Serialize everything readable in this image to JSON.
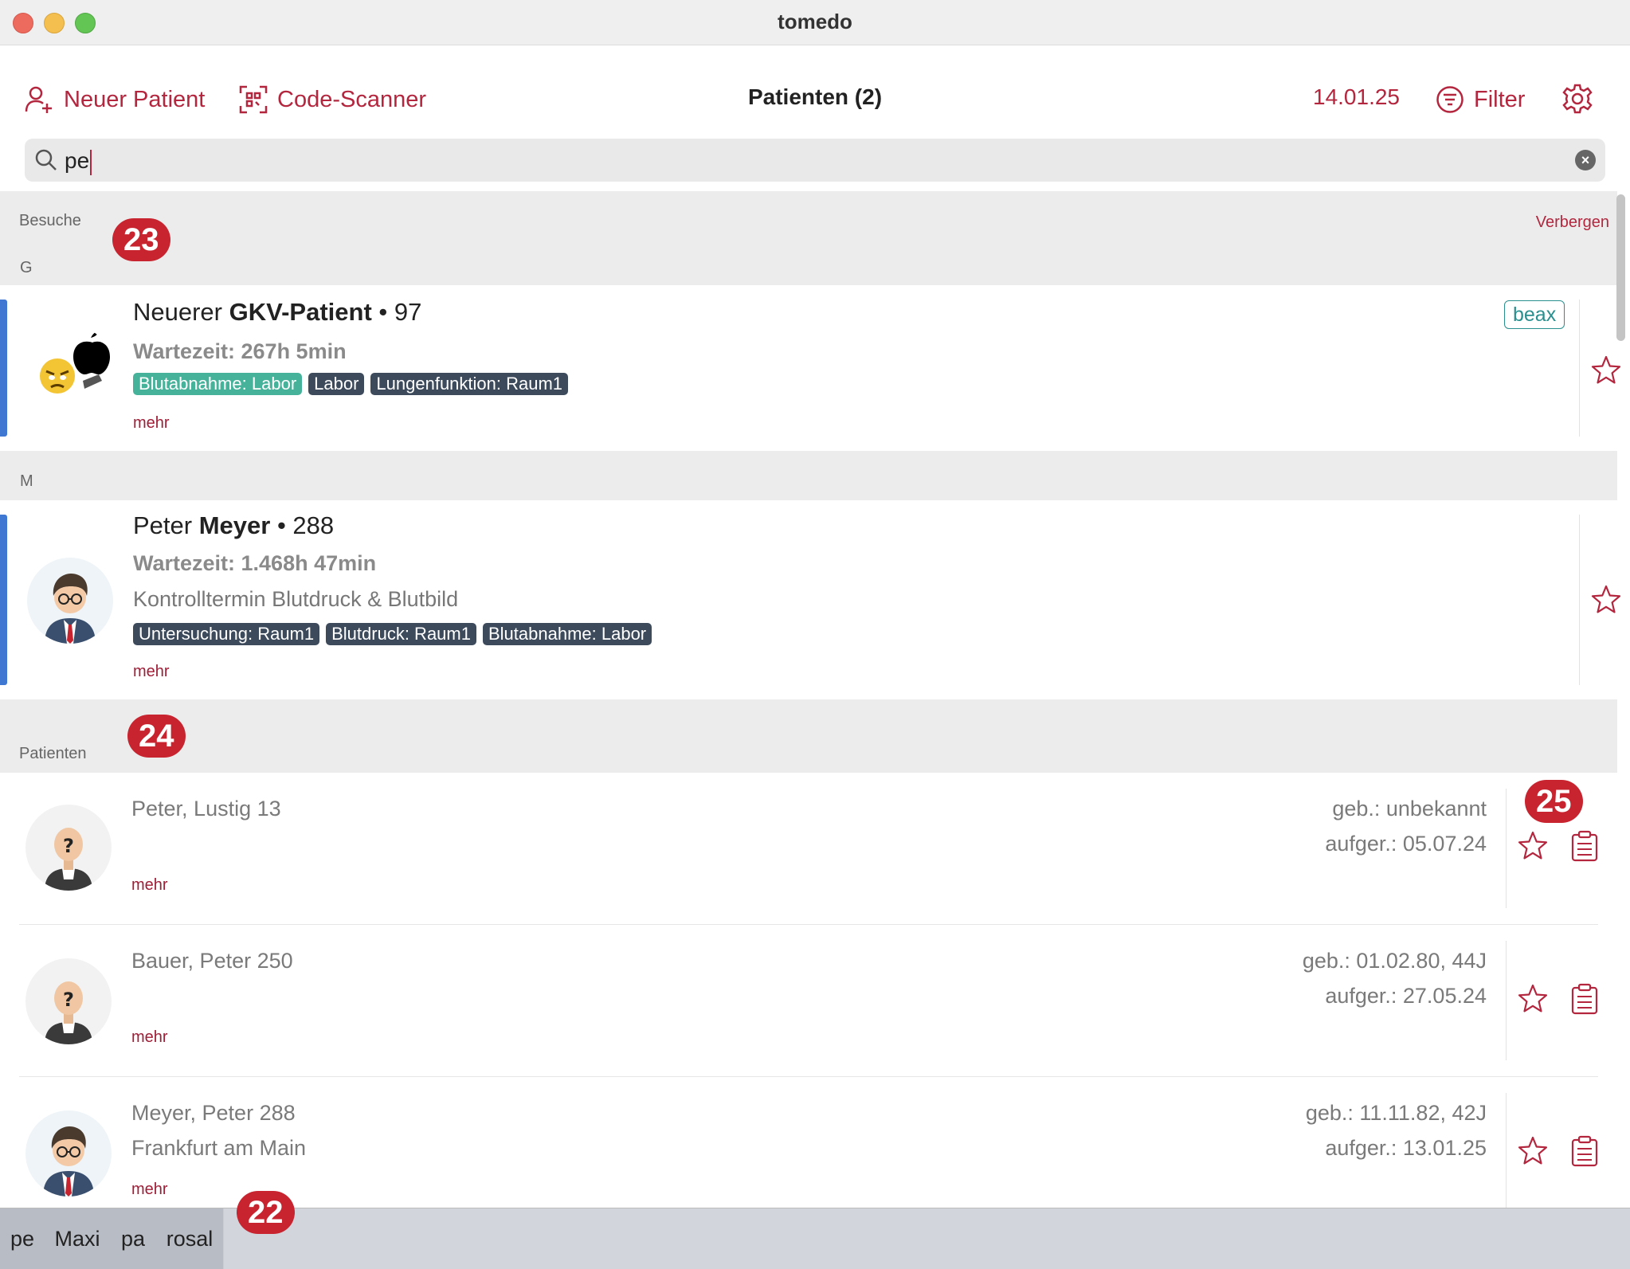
{
  "window": {
    "title": "tomedo"
  },
  "toolbar": {
    "new_patient": "Neuer Patient",
    "code_scanner": "Code-Scanner",
    "title": "Patienten (2)",
    "date": "14.01.25",
    "filter": "Filter"
  },
  "search": {
    "value": "pe"
  },
  "visits": {
    "section_label": "Besuche",
    "hide_label": "Verbergen",
    "groups": [
      {
        "letter": "G"
      },
      {
        "letter": "M"
      }
    ],
    "items": [
      {
        "first_name": "Neuerer",
        "last_name": "GKV-Patient",
        "number": "• 97",
        "wait": "Wartezeit: 267h 5min",
        "note": "",
        "tags": [
          "Blutabnahme: Labor",
          "Labor",
          "Lungenfunktion: Raum1"
        ],
        "more": "mehr",
        "badge": "beax"
      },
      {
        "first_name": "Peter",
        "last_name": "Meyer",
        "number": "• 288",
        "wait": "Wartezeit: 1.468h 47min",
        "note": "Kontrolltermin Blutdruck & Blutbild",
        "tags": [
          "Untersuchung: Raum1",
          "Blutdruck: Raum1",
          "Blutabnahme: Labor"
        ],
        "more": "mehr"
      }
    ]
  },
  "patients": {
    "section_label": "Patienten",
    "items": [
      {
        "name": "Peter, Lustig  13",
        "sub": "",
        "birth": "geb.: unbekannt",
        "called": "aufger.: 05.07.24",
        "more": "mehr"
      },
      {
        "name": "Bauer, Peter  250",
        "sub": "",
        "birth": "geb.: 01.02.80, 44J",
        "called": "aufger.: 27.05.24",
        "more": "mehr"
      },
      {
        "name": "Meyer, Peter  288",
        "sub": "Frankfurt am Main",
        "birth": "geb.: 11.11.82, 42J",
        "called": "aufger.: 13.01.25",
        "more": "mehr"
      }
    ]
  },
  "history": [
    "pe",
    "Maxi",
    "pa",
    "rosal"
  ],
  "callouts": [
    "23",
    "24",
    "25",
    "22"
  ],
  "colors": {
    "accent": "#b3263e",
    "badge": "#c8242f",
    "visit_bar": "#3f78d3",
    "tag_green": "#47b29a",
    "tag_dark": "#3c4a5c"
  }
}
